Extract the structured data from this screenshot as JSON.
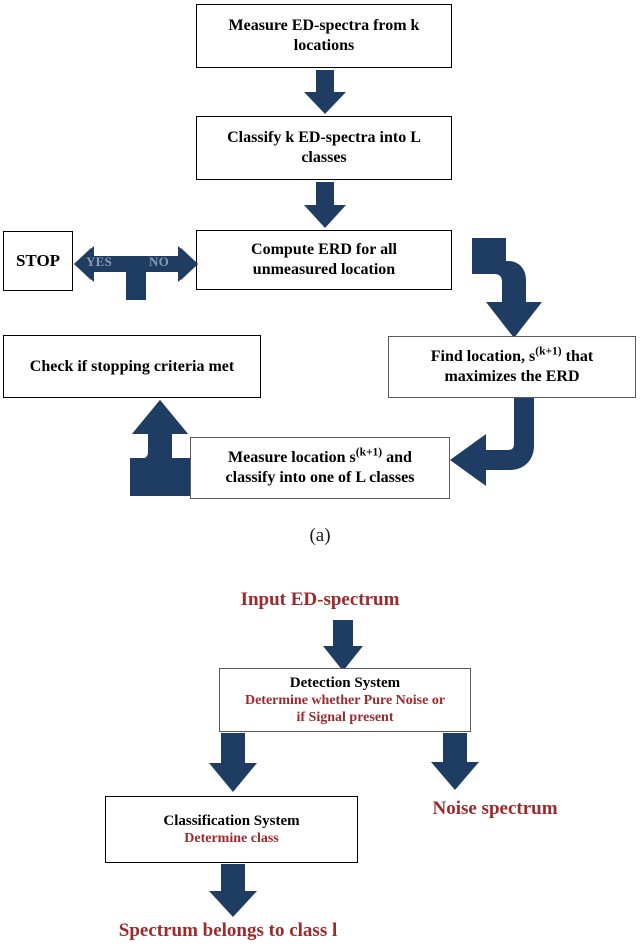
{
  "colors": {
    "arrow_navy": "#1f3c62",
    "red_text": "#9c2a2c",
    "box_border": "#000000",
    "yes_no_label": "#8a9cb0",
    "background": "#ffffff"
  },
  "diagram_a": {
    "caption": "(a)",
    "boxes": {
      "measure_spectra": {
        "line1": "Measure ED-spectra from k",
        "line2": "locations"
      },
      "classify_spectra": {
        "line1": "Classify k ED-spectra into L",
        "line2": "classes"
      },
      "compute_erd": {
        "line1": "Compute ERD for all",
        "line2": "unmeasured location"
      },
      "stop": {
        "line1": "STOP"
      },
      "check_stopping": {
        "line1": "Check if stopping criteria met"
      },
      "find_location": {
        "line1_a": "Find location, s",
        "line1_sup": "(k+1)",
        "line1_b": " that",
        "line2": "maximizes the ERD"
      },
      "measure_location": {
        "line1_a": "Measure location s",
        "line1_sup": "(k+1)",
        "line1_b": " and",
        "line2": "classify into one of L classes"
      }
    },
    "decision_labels": {
      "yes": "YES",
      "no": "NO"
    }
  },
  "diagram_b": {
    "input_label": "Input ED-spectrum",
    "detection_system": {
      "title": "Detection System",
      "line1": "Determine whether Pure Noise or",
      "line2": "if Signal present"
    },
    "classification_system": {
      "title": "Classification System",
      "line1": "Determine class"
    },
    "noise_output": "Noise spectrum",
    "class_output": "Spectrum belongs to class l"
  }
}
